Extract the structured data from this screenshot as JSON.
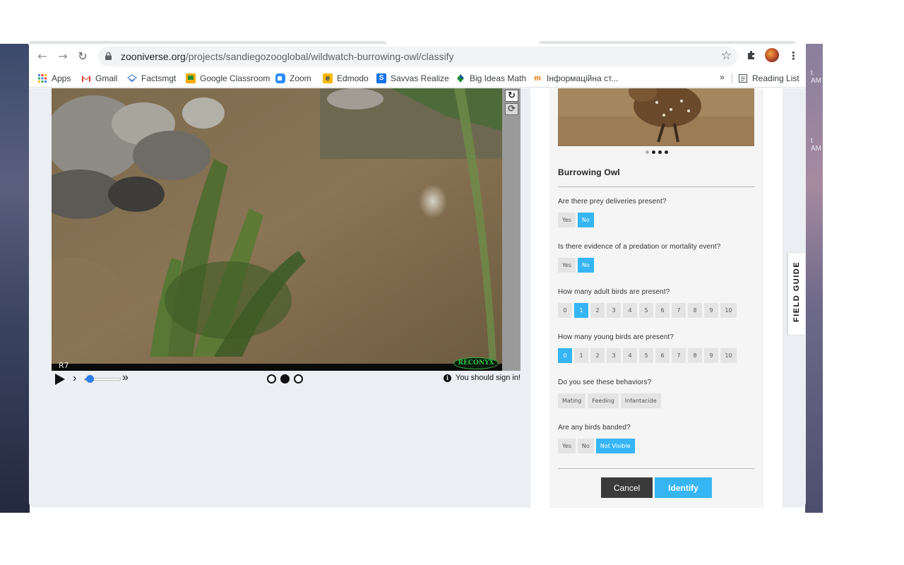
{
  "desktop": {
    "time_labels": [
      "t\nAM",
      "t\nAM"
    ]
  },
  "browser": {
    "url_host": "zooniverse.org",
    "url_path": "/projects/sandiegozooglobal/wildwatch-burrowing-owl/classify",
    "nav": {
      "back_icon": "back-arrow-icon",
      "forward_icon": "forward-arrow-icon",
      "reload_icon": "reload-icon"
    }
  },
  "bookmarks": {
    "items": [
      {
        "label": "Apps",
        "color": "#4285f4"
      },
      {
        "label": "Gmail",
        "color": "#ea4335"
      },
      {
        "label": "Factsmgt",
        "color": "#8ab4f8"
      },
      {
        "label": "Google Classroom",
        "color": "#f9ab00"
      },
      {
        "label": "Zoom",
        "color": "#2d8cff"
      },
      {
        "label": "Edmodo",
        "color": "#f6b900"
      },
      {
        "label": "Savvas Realize",
        "color": "#1a73e8"
      },
      {
        "label": "Big Ideas Math",
        "color": "#1e8e3e"
      },
      {
        "label": "Інформаційна ст...",
        "color": "#e37400"
      }
    ],
    "more": "»",
    "reading_list": "Reading List"
  },
  "viewer": {
    "camera_label": "R7",
    "watermark": "RECONYX",
    "signin_text": "You should sign in!",
    "speed_level": 0.1,
    "frames": {
      "count": 3,
      "active_index": 1
    }
  },
  "task": {
    "species_name": "Burrowing Owl",
    "carousel": {
      "count": 4,
      "active_index": 0
    },
    "questions": [
      {
        "text": "Are there prey deliveries present?",
        "options": [
          "Yes",
          "No"
        ],
        "selected": [
          "No"
        ]
      },
      {
        "text": "Is there evidence of a predation or mortality event?",
        "options": [
          "Yes",
          "No"
        ],
        "selected": [
          "No"
        ]
      },
      {
        "text": "How many adult birds are present?",
        "options": [
          "0",
          "1",
          "2",
          "3",
          "4",
          "5",
          "6",
          "7",
          "8",
          "9",
          "10"
        ],
        "selected": [
          "1"
        ]
      },
      {
        "text": "How many young birds are present?",
        "options": [
          "0",
          "1",
          "2",
          "3",
          "4",
          "5",
          "6",
          "7",
          "8",
          "9",
          "10"
        ],
        "selected": [
          "0"
        ]
      },
      {
        "text": "Do you see these behaviors?",
        "options": [
          "Mating",
          "Feeding",
          "Infantacide"
        ],
        "selected": []
      },
      {
        "text": "Are any birds banded?",
        "options": [
          "Yes",
          "No",
          "Not Visible"
        ],
        "selected": [
          "Not Visible"
        ]
      }
    ],
    "cancel_label": "Cancel",
    "identify_label": "Identify"
  },
  "field_guide_label": "FIELD GUIDE",
  "colors": {
    "accent": "#36b5f5",
    "dark_button": "#3a3a3a"
  }
}
